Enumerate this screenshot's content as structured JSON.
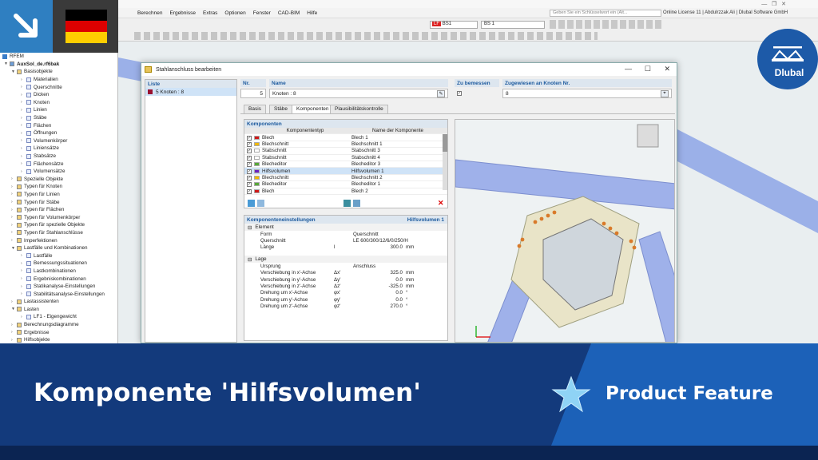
{
  "menu": [
    "Berechnen",
    "Ergebnisse",
    "Extras",
    "Optionen",
    "Fenster",
    "CAD-BIM",
    "Hilfe"
  ],
  "search_placeholder": "Geben Sie ein Schlüsselwort ein (Alt...",
  "license": "Online License 11 | Abdulrzzak Ali | Dlubal Software GmbH",
  "lc_select": "BS1",
  "lc_name": "BS 1",
  "nav": {
    "root": "RFEM",
    "file": "AuxSol_de.rf6bak",
    "items": [
      {
        "t": "Basisobjekte",
        "l": 1,
        "open": true
      },
      {
        "t": "Materialien",
        "l": 2
      },
      {
        "t": "Querschnitte",
        "l": 2
      },
      {
        "t": "Dicken",
        "l": 2
      },
      {
        "t": "Knoten",
        "l": 2
      },
      {
        "t": "Linien",
        "l": 2
      },
      {
        "t": "Stäbe",
        "l": 2
      },
      {
        "t": "Flächen",
        "l": 2
      },
      {
        "t": "Öffnungen",
        "l": 2
      },
      {
        "t": "Volumenkörper",
        "l": 2
      },
      {
        "t": "Liniensätze",
        "l": 2
      },
      {
        "t": "Stabsätze",
        "l": 2
      },
      {
        "t": "Flächensätze",
        "l": 2
      },
      {
        "t": "Volumensätze",
        "l": 2
      },
      {
        "t": "Spezielle Objekte",
        "l": 1
      },
      {
        "t": "Typen für Knoten",
        "l": 1
      },
      {
        "t": "Typen für Linien",
        "l": 1
      },
      {
        "t": "Typen für Stäbe",
        "l": 1
      },
      {
        "t": "Typen für Flächen",
        "l": 1
      },
      {
        "t": "Typen für Volumenkörper",
        "l": 1
      },
      {
        "t": "Typen für spezielle Objekte",
        "l": 1
      },
      {
        "t": "Typen für Stahlanschlüsse",
        "l": 1
      },
      {
        "t": "Imperfektionen",
        "l": 1
      },
      {
        "t": "Lastfälle und Kombinationen",
        "l": 1,
        "open": true
      },
      {
        "t": "Lastfälle",
        "l": 2
      },
      {
        "t": "Bemessungssituationen",
        "l": 2
      },
      {
        "t": "Lastkombinationen",
        "l": 2
      },
      {
        "t": "Ergebniskombinationen",
        "l": 2
      },
      {
        "t": "Statikanalyse-Einstellungen",
        "l": 2
      },
      {
        "t": "Stabilitätsanalyse-Einstellungen",
        "l": 2
      },
      {
        "t": "Lastassistenten",
        "l": 1
      },
      {
        "t": "Lasten",
        "l": 1,
        "open": true
      },
      {
        "t": "LF1 - Eigengewicht",
        "l": 2
      },
      {
        "t": "Berechnungsdiagramme",
        "l": 1
      },
      {
        "t": "Ergebnisse",
        "l": 1
      },
      {
        "t": "Hilfsobjekte",
        "l": 1
      }
    ]
  },
  "dialog": {
    "title": "Stahlanschluss bearbeiten",
    "liste_header": "Liste",
    "liste_item": "5  Knoten : 8",
    "nr_label": "Nr.",
    "nr_value": "5",
    "name_label": "Name",
    "name_value": "Knoten : 8",
    "zu_label": "Zu bemessen",
    "zugew_label": "Zugewiesen an Knoten Nr.",
    "zugew_value": "8",
    "tabs": [
      "Basis",
      "Stäbe",
      "Komponenten",
      "Plausibilitätskontrolle"
    ],
    "komp_header": "Komponenten",
    "col_type": "Komponententyp",
    "col_name": "Name der Komponente",
    "rows": [
      {
        "type": "Blech",
        "name": "Blech 1",
        "color": "#d01818"
      },
      {
        "type": "Blechschnitt",
        "name": "Blechschnitt 1",
        "color": "#f0b800"
      },
      {
        "type": "Stabschnitt",
        "name": "Stabschnitt 3",
        "color": "#ffffff"
      },
      {
        "type": "Stabschnitt",
        "name": "Stabschnitt 4",
        "color": "#ffffff"
      },
      {
        "type": "Blecheditor",
        "name": "Blecheditor 3",
        "color": "#58a838"
      },
      {
        "type": "Hilfsvolumen",
        "name": "Hilfsvolumen 1",
        "color": "#6a1fc0"
      },
      {
        "type": "Blechschnitt",
        "name": "Blechschnitt 2",
        "color": "#f0b800"
      },
      {
        "type": "Blecheditor",
        "name": "Blecheditor 1",
        "color": "#58a838"
      },
      {
        "type": "Blech",
        "name": "Blech 2",
        "color": "#d01818"
      }
    ],
    "settings_header": "Komponenteneinstellungen",
    "settings_right": "Hilfsvolumen 1",
    "element_grp": "Element",
    "element": [
      {
        "l": "Form",
        "s": "",
        "v": "Querschnitt",
        "u": ""
      },
      {
        "l": "Querschnitt",
        "s": "",
        "v": "LE 600/300/12/6/0/250/H",
        "u": ""
      },
      {
        "l": "Länge",
        "s": "l",
        "v": "300.0",
        "u": "mm"
      }
    ],
    "lage_grp": "Lage",
    "lage": [
      {
        "l": "Ursprung",
        "s": "",
        "v": "Anschluss",
        "u": ""
      },
      {
        "l": "Verschiebung in x'-Achse",
        "s": "Δx'",
        "v": "325.0",
        "u": "mm"
      },
      {
        "l": "Verschiebung in y'-Achse",
        "s": "Δy'",
        "v": "0.0",
        "u": "mm"
      },
      {
        "l": "Verschiebung in z'-Achse",
        "s": "Δz'",
        "v": "-325.0",
        "u": "mm"
      },
      {
        "l": "Drehung um x'-Achse",
        "s": "φx'",
        "v": "0.0",
        "u": "°"
      },
      {
        "l": "Drehung um y'-Achse",
        "s": "φy'",
        "v": "0.0",
        "u": "°"
      },
      {
        "l": "Drehung um z'-Achse",
        "s": "φz'",
        "v": "270.0",
        "u": "°"
      }
    ]
  },
  "banner": {
    "headline": "Komponente 'Hilfsvolumen'",
    "feature": "Product Feature",
    "logo": "Dlubal"
  },
  "colors": {
    "banner_dark": "#133a7c",
    "banner_light": "#1c61b8",
    "accent_blue": "#2f7fc1"
  }
}
